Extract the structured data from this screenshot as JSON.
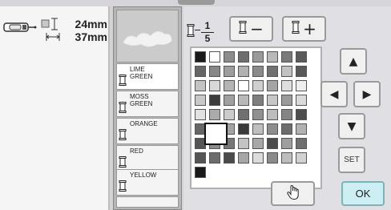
{
  "icons": {
    "machine": "embroidery-frame-icon",
    "height": "vertical-dimension-icon",
    "width": "horizontal-dimension-icon",
    "bobbin": "thread-bobbin-icon",
    "up": "up-arrow-icon",
    "down": "down-arrow-icon",
    "left": "left-arrow-icon",
    "right": "right-arrow-icon",
    "hand": "hand-pointer-icon"
  },
  "design_size": {
    "height": "24mm",
    "width": "37mm"
  },
  "color_list": [
    {
      "name": "LIME\nGREEN",
      "color": "#7fbf3f"
    },
    {
      "name": "MOSS\nGREEN",
      "color": "#5d7a34"
    },
    {
      "name": "ORANGE",
      "color": "#ff8a1e"
    },
    {
      "name": "RED",
      "color": "#d02020"
    },
    {
      "name": "YELLOW",
      "color": "#f2d100"
    }
  ],
  "thread_count": {
    "current": "1",
    "total": "5"
  },
  "toolbar": {
    "minus_label": "−",
    "plus_label": "+"
  },
  "palette": {
    "rows": [
      [
        "#1a1a1a",
        "#ffffff",
        "#8c8c8c",
        "#6e6e6e",
        "#9a9a9a",
        "#b8b8b8",
        "#7a7a7a",
        "#5a5a5a"
      ],
      [
        "#666666",
        "#888888",
        "#9d9d9d",
        "#b0b0b0",
        "#8a8a8a",
        "#707070",
        "#c2c2c2",
        "#595959"
      ],
      [
        "#c4c4c4",
        "#d8d8d8",
        "#b5b5b5",
        "#ffffff",
        "#cfcfcf",
        "#a5a5a5",
        "#dedede",
        "#eeeeee"
      ],
      [
        "#c9c9c9",
        "#3d3d3d",
        "#a0a0a0",
        "#b9b9b9",
        "#7e7e7e",
        "#c7c7c7",
        "#9b9b9b",
        "#dadada"
      ],
      [
        "#e2e2e2",
        "#aaaaaa",
        "#cccccc",
        "#707070",
        "#909090",
        "#bcbcbc",
        "#858585",
        "#4e4e4e"
      ],
      [
        "#666666",
        "#dcdcdc",
        "#a4a4a4",
        "#3a3a3a",
        "#bfbfbf",
        "#8e8e8e",
        "#6d6d6d",
        "#b2b2b2"
      ],
      [
        "#555555",
        "#8d8d8d",
        "#777777",
        "#c3c3c3",
        "#a7a7a7",
        "#4c4c4c",
        "#9e9e9e",
        "#6f6f6f"
      ],
      [
        "#555555",
        "#6c6c6c",
        "#4a4a4a",
        "#a6a6a6",
        "#dcdcdc",
        "#8b8b8b",
        "#bdbdbd",
        "#d2d2d2"
      ],
      [
        "#1a1a1a",
        "",
        "",
        "",
        "",
        "",
        "",
        ""
      ]
    ]
  },
  "buttons": {
    "set_label": "SET",
    "ok_label": "OK"
  }
}
